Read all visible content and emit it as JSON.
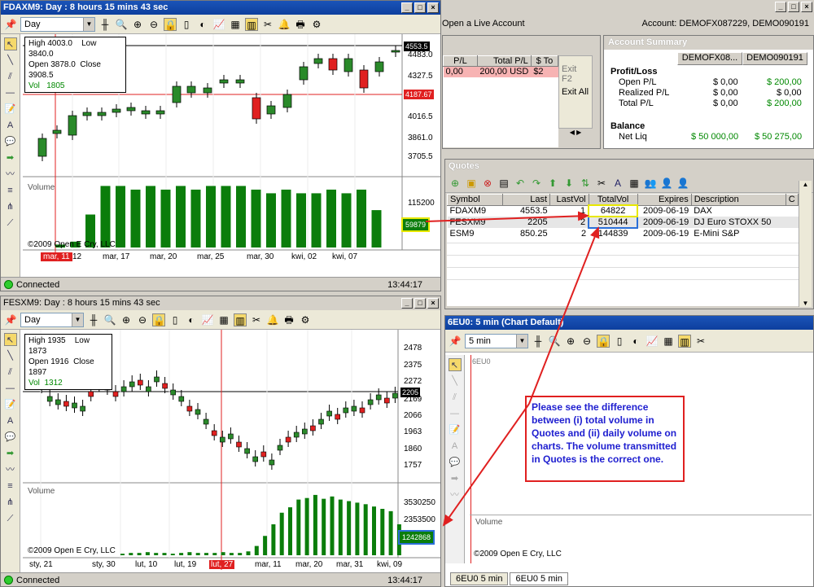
{
  "colors": {
    "up": "#2a8a2a",
    "down": "#e02020",
    "volume": "#0b7d0b",
    "title": "#0d3f9e",
    "accent_yellow": "#e8e800",
    "accent_blue": "#2a6fd8"
  },
  "chart1": {
    "title": "FDAXM9: Day : 8 hours 15 mins 43 sec",
    "period": "Day",
    "ohlc": {
      "high_label": "High",
      "high": "4003.0",
      "low_label": "Low",
      "low": "3840.0",
      "open_label": "Open",
      "open": "3878.0",
      "close_label": "Close",
      "close": "3908.5",
      "vol_label": "Vol",
      "vol": "1805"
    },
    "price_ticks": [
      "4483.0",
      "4327.5",
      "4171.0",
      "4016.5",
      "3861.0",
      "3705.5"
    ],
    "last_price": "4553.5",
    "red_line_price": "4187.67",
    "volume_label": "Volume",
    "volume_tick": "115200",
    "volume_box": "59879",
    "copyright": "©2009 Open E Cry, LLC",
    "date_ticks": [
      "mar, 11",
      "12",
      "mar, 17",
      "mar, 20",
      "mar, 25",
      "mar, 30",
      "kwi, 02",
      "kwi, 07"
    ],
    "status": "Connected",
    "time": "13:44:17"
  },
  "chart2": {
    "title": "FESXM9: Day : 8 hours 15 mins 43 sec",
    "period": "Day",
    "ohlc": {
      "high_label": "High",
      "high": "1935",
      "low_label": "Low",
      "low": "1873",
      "open_label": "Open",
      "open": "1916",
      "close_label": "Close",
      "close": "1897",
      "vol_label": "Vol",
      "vol": "1312"
    },
    "price_ticks": [
      "2478",
      "2375",
      "2272",
      "2169",
      "2066",
      "1963",
      "1860",
      "1757"
    ],
    "last_price": "2205",
    "volume_label": "Volume",
    "volume_ticks": [
      "3530250",
      "2353500"
    ],
    "volume_box": "1242868",
    "copyright": "©2009 Open E Cry, LLC",
    "date_ticks": [
      "sty, 21",
      "sty, 30",
      "lut, 10",
      "lut, 19",
      "lut, 27",
      "mar, 11",
      "mar, 20",
      "mar, 31",
      "kwi, 09"
    ],
    "status": "Connected",
    "time": "13:44:17"
  },
  "account_bar": {
    "open_live": "Open a Live Account",
    "account": "Account: DEMOFX087229, DEMO090191"
  },
  "positions": {
    "cols": [
      "P/L",
      "Total P/L",
      "$ To"
    ],
    "row": [
      "0,00",
      "200,00 USD",
      "$2"
    ],
    "exit_f2": "Exit F2",
    "exit_all": "Exit All"
  },
  "account_summary": {
    "title": "Account Summary",
    "cols": [
      "DEMOFX08...",
      "DEMO090191"
    ],
    "pl_header": "Profit/Loss",
    "rows": [
      {
        "label": "Open P/L",
        "a": "$ 0,00",
        "b": "$ 200,00"
      },
      {
        "label": "Realized P/L",
        "a": "$ 0,00",
        "b": "$ 0,00"
      },
      {
        "label": "Total P/L",
        "a": "$ 0,00",
        "b": "$ 200,00"
      }
    ],
    "balance_header": "Balance",
    "net_liq": {
      "label": "Net Liq",
      "a": "$ 50 000,00",
      "b": "$ 50 275,00"
    }
  },
  "quotes": {
    "title": "Quotes",
    "cols": [
      "Symbol",
      "Last",
      "LastVol",
      "TotalVol",
      "Expires",
      "Description",
      "C"
    ],
    "rows": [
      [
        "FDAXM9",
        "4553.5",
        "1",
        "64822",
        "2009-06-19",
        "DAX"
      ],
      [
        "FESXM9",
        "2205",
        "2",
        "510444",
        "2009-06-19",
        "DJ Euro STOXX 50"
      ],
      [
        "ESM9",
        "850.25",
        "2",
        "144839",
        "2009-06-19",
        "E-Mini S&P"
      ]
    ]
  },
  "chart3": {
    "title": "6EU0: 5 min (Chart Default)",
    "period": "5 min",
    "symbol": "6EU0",
    "volume_label": "Volume",
    "copyright": "©2009 Open E Cry, LLC",
    "tabs": [
      "6EU0 5 min",
      "6EU0 5 min"
    ]
  },
  "note": "Please see the difference between (i) total volume in Quotes and (ii) daily volume on charts. The volume transmitted in Quotes is the correct one.",
  "chart_data": [
    {
      "type": "bar",
      "title": "",
      "series": [
        {
          "values": [
            4,
            8,
            45,
            84,
            84,
            79,
            84,
            79,
            84,
            79,
            84,
            84,
            84,
            79,
            74,
            79,
            74,
            74,
            79,
            74,
            79,
            51
          ]
        }
      ],
      "ylabel": "",
      "xlabel": ""
    },
    {
      "type": "bar",
      "title": "",
      "series": [
        {
          "values": [
            2,
            3,
            3,
            4,
            3,
            3,
            2,
            3,
            4,
            3,
            3,
            3,
            4,
            3,
            3,
            5,
            12,
            25,
            40,
            55,
            62,
            72,
            74,
            78,
            73,
            76,
            72,
            70,
            68,
            66,
            63,
            60,
            57,
            40
          ]
        }
      ],
      "ylabel": "",
      "xlabel": ""
    }
  ]
}
